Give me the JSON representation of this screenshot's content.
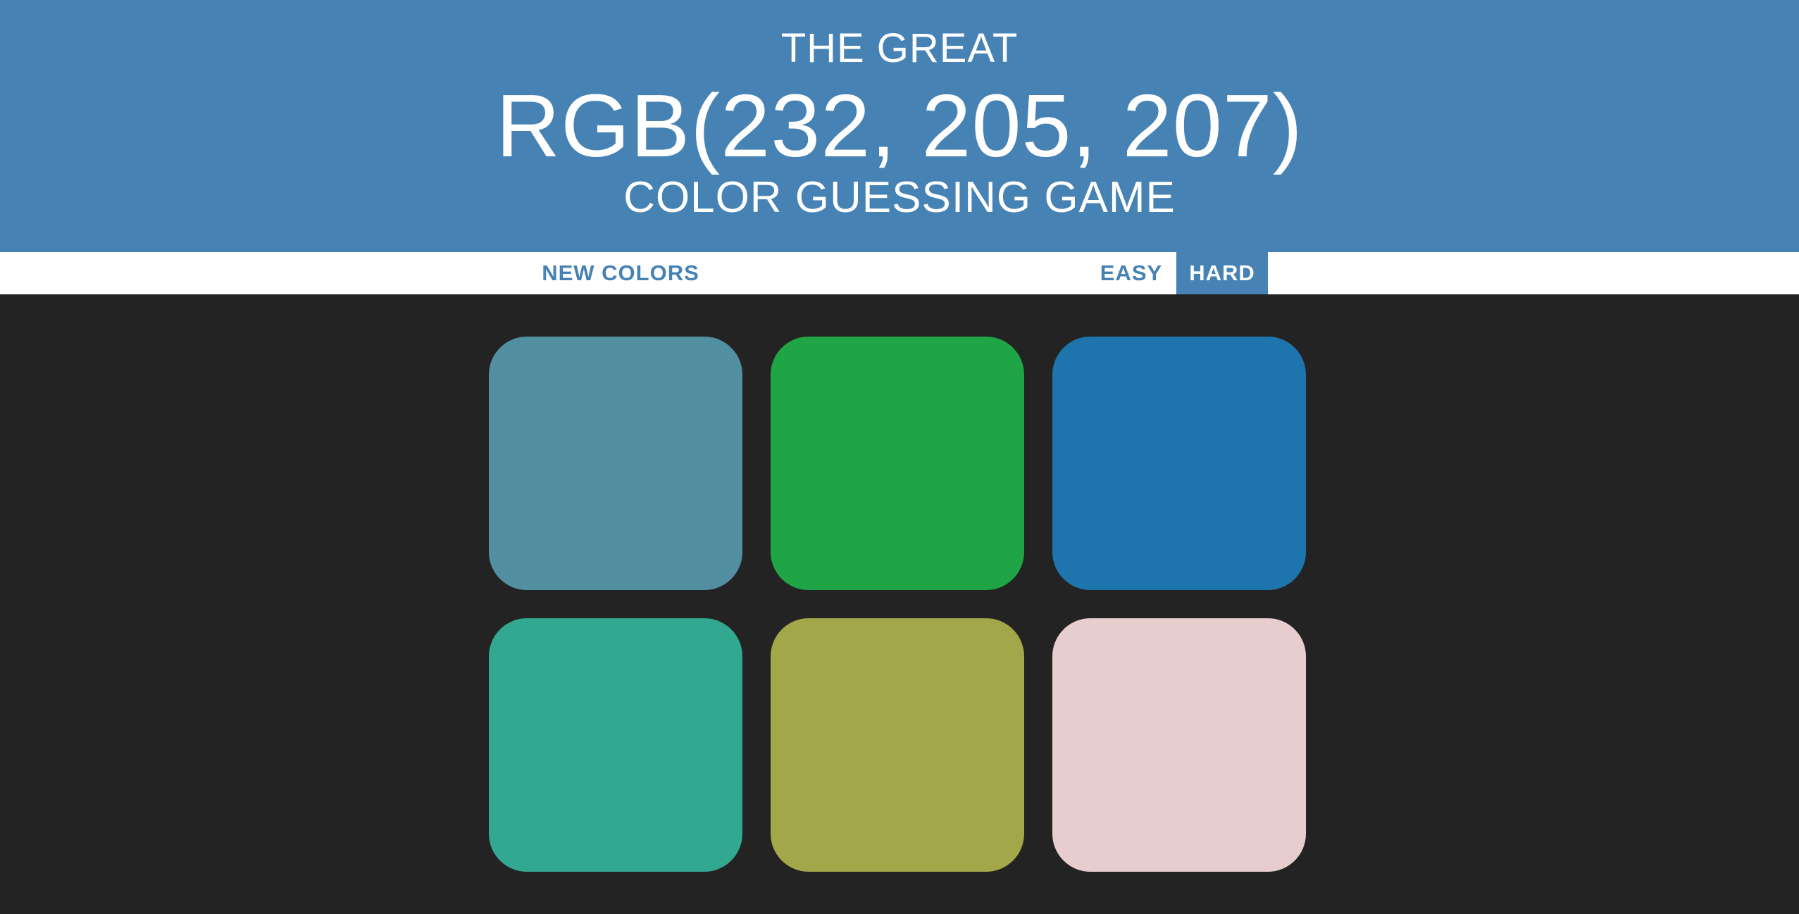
{
  "header": {
    "line1": "THE GREAT",
    "target_rgb": "RGB(232, 205, 207)",
    "line3": "COLOR GUESSING GAME",
    "background": "#4682b4"
  },
  "controls": {
    "new_colors_label": "NEW COLORS",
    "easy_label": "EASY",
    "hard_label": "HARD",
    "selected_mode": "HARD",
    "message": ""
  },
  "squares": [
    {
      "color": "#528fa1"
    },
    {
      "color": "#1fa546"
    },
    {
      "color": "#1e74ad"
    },
    {
      "color": "#33a891"
    },
    {
      "color": "#a2a749"
    },
    {
      "color": "#e8cdcf"
    }
  ],
  "colors": {
    "page_background": "#232323",
    "stripe": "#ffffff",
    "accent": "#4682b4"
  }
}
